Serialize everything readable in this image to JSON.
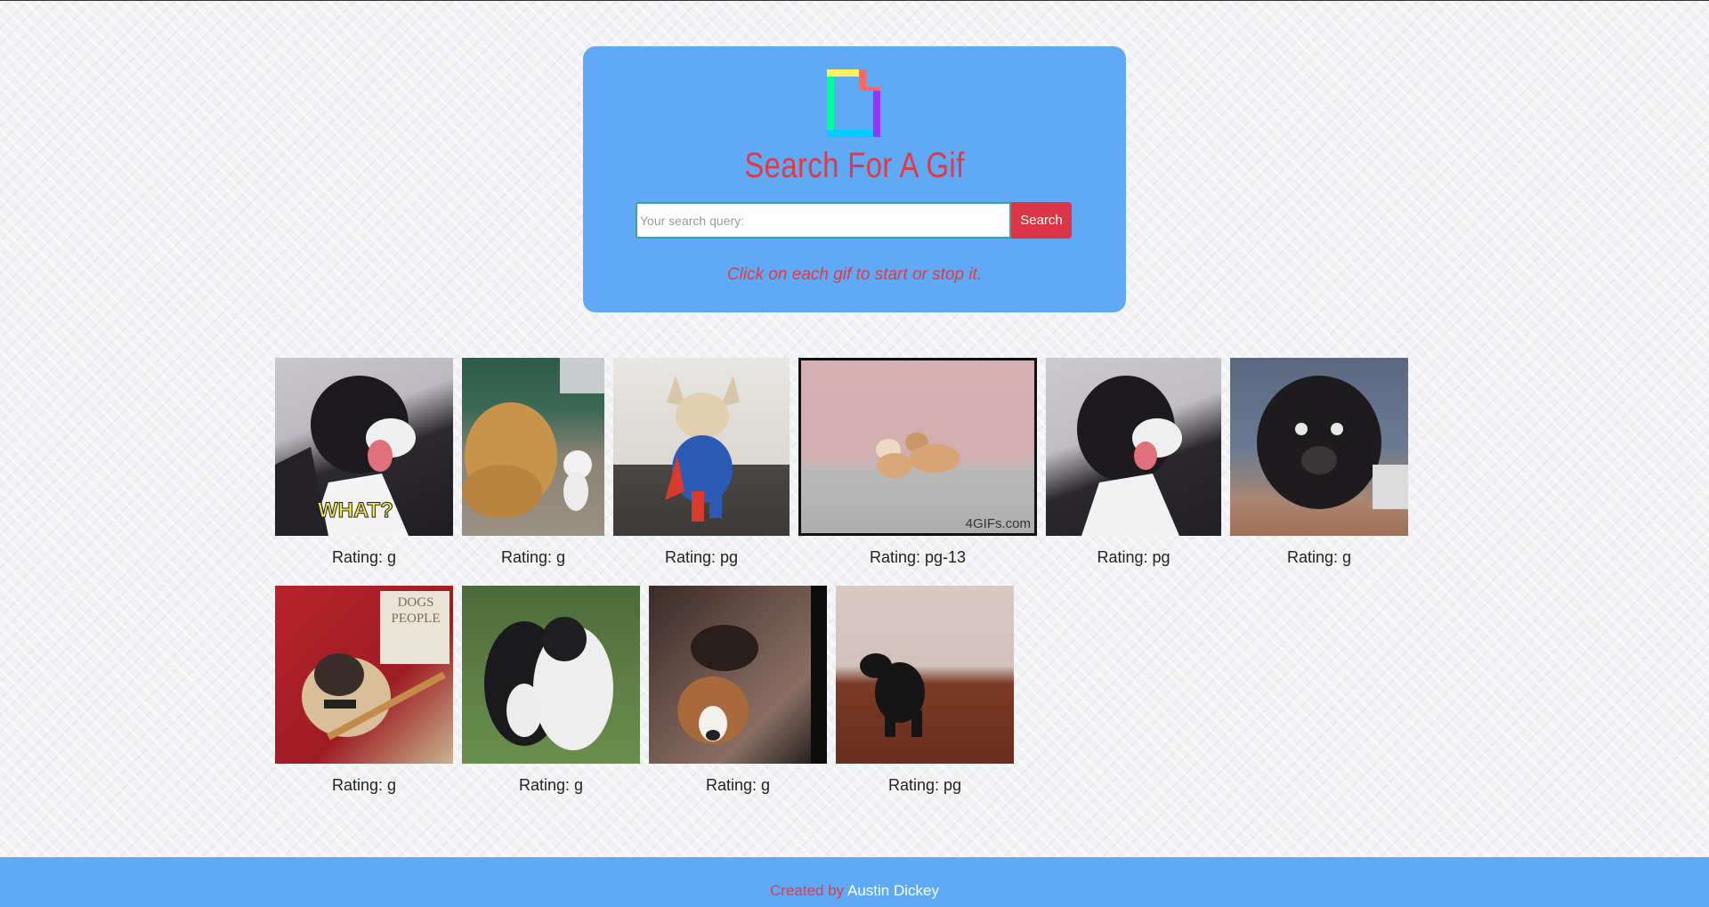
{
  "header": {
    "title": "Search For A Gif",
    "search_placeholder": "Your search query:",
    "search_button": "Search",
    "hint": "Click on each gif to start or stop it."
  },
  "gifs": [
    {
      "rating": "Rating: g",
      "alt": "dog what",
      "badge": "WHAT?"
    },
    {
      "rating": "Rating: g",
      "alt": "golden retriever and kitten"
    },
    {
      "rating": "Rating: pg",
      "alt": "chihuahua superman costume"
    },
    {
      "rating": "Rating: pg-13",
      "alt": "two small dogs",
      "badge": "4GIFs.com"
    },
    {
      "rating": "Rating: pg",
      "alt": "dog looking up"
    },
    {
      "rating": "Rating: g",
      "alt": "black dog surprised"
    },
    {
      "rating": "Rating: g",
      "alt": "pug with bowtie",
      "badge": "DOGS PEOPLE"
    },
    {
      "rating": "Rating: g",
      "alt": "two border collies"
    },
    {
      "rating": "Rating: g",
      "alt": "jack russell puppy"
    },
    {
      "rating": "Rating: pg",
      "alt": "dachshund"
    }
  ],
  "footer": {
    "prefix": "Created by",
    "author": "Austin Dickey"
  },
  "colors": {
    "header_bg": "#60a9f4",
    "accent_red": "#e03a46",
    "button_red": "#dc3545"
  }
}
